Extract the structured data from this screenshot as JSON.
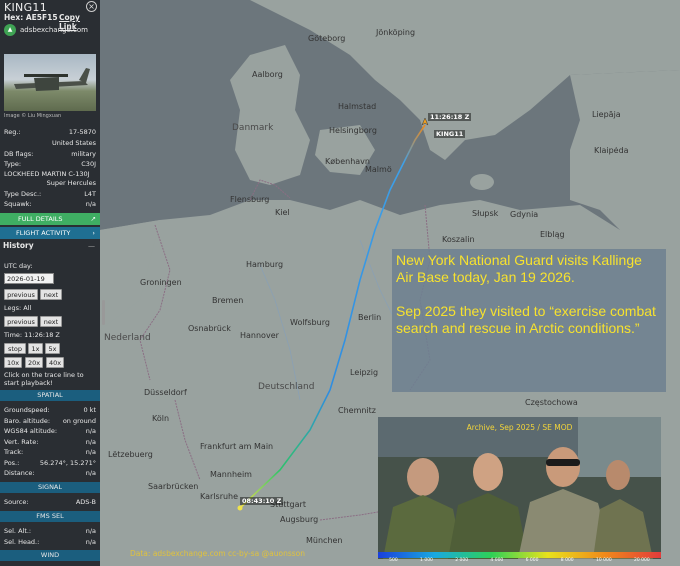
{
  "sidebar": {
    "callsign": "KING11",
    "hex_label": "Hex:",
    "hex": "AE5F15",
    "copy_link": "Copy Link",
    "source_site": "adsbexchange.com",
    "image_credit": "Image © Liu Mingxuan",
    "fields": [
      {
        "label": "Reg.:",
        "value": "17-5870"
      },
      {
        "label": "",
        "value": "United States"
      },
      {
        "label": "DB flags:",
        "value": "military"
      },
      {
        "label": "Type:",
        "value": "C30J"
      },
      {
        "label": "LOCKHEED MARTIN C-130J",
        "value": ""
      },
      {
        "label": "",
        "value": "Super Hercules"
      },
      {
        "label": "Type Desc.:",
        "value": "L4T"
      },
      {
        "label": "Squawk:",
        "value": "n/a"
      }
    ],
    "full_details": "FULL DETAILS",
    "flight_activity": "FLIGHT ACTIVITY",
    "history": "History",
    "utc_day_label": "UTC day:",
    "utc_day_value": "2026-01-19",
    "previous": "previous",
    "next": "next",
    "legs_label": "Legs: All",
    "time_label": "Time: 11:26:18 Z",
    "stop": "stop",
    "speeds": [
      "1x",
      "5x",
      "10x",
      "20x",
      "40x"
    ],
    "trace_hint": "Click on the trace line to start playback!",
    "spatial_header": "SPATIAL",
    "spatial": [
      {
        "label": "Groundspeed:",
        "value": "0 kt"
      },
      {
        "label": "Baro. altitude:",
        "value": "on ground"
      },
      {
        "label": "WGS84 altitude:",
        "value": "n/a"
      },
      {
        "label": "Vert. Rate:",
        "value": "n/a"
      },
      {
        "label": "Track:",
        "value": "n/a"
      },
      {
        "label": "Pos.:",
        "value": "56.274°, 15.271°"
      },
      {
        "label": "Distance:",
        "value": "n/a"
      }
    ],
    "signal_header": "SIGNAL",
    "signal": [
      {
        "label": "Source:",
        "value": "ADS-B"
      }
    ],
    "fms_header": "FMS SEL",
    "fms": [
      {
        "label": "Sel. Alt.:",
        "value": "n/a"
      },
      {
        "label": "Sel. Head.:",
        "value": "n/a"
      }
    ],
    "wind_header": "WIND"
  },
  "map": {
    "flight_label_end": "11:26:18 Z",
    "flight_label_callsign": "KING11",
    "flight_label_start": "08:43:10 Z",
    "labels": [
      {
        "text": "Göteborg"
      },
      {
        "text": "Jönköping"
      },
      {
        "text": "Aalborg"
      },
      {
        "text": "Halmstad"
      },
      {
        "text": "Danmark"
      },
      {
        "text": "Helsingborg"
      },
      {
        "text": "København"
      },
      {
        "text": "Malmö"
      },
      {
        "text": "Liepāja"
      },
      {
        "text": "Klaipėda"
      },
      {
        "text": "Flensburg"
      },
      {
        "text": "Kiel"
      },
      {
        "text": "Gdynia"
      },
      {
        "text": "Słupsk"
      },
      {
        "text": "Elbląg"
      },
      {
        "text": "Koszalin"
      },
      {
        "text": "Hamburg"
      },
      {
        "text": "Groningen"
      },
      {
        "text": "Bremen"
      },
      {
        "text": "Berlin"
      },
      {
        "text": "Nederland"
      },
      {
        "text": "Osnabrück"
      },
      {
        "text": "Hannover"
      },
      {
        "text": "Wolfsburg"
      },
      {
        "text": "Deutschland"
      },
      {
        "text": "Leipzig"
      },
      {
        "text": "Düsseldorf"
      },
      {
        "text": "Köln"
      },
      {
        "text": "Frankfurt am Main"
      },
      {
        "text": "Lëtzebuerg"
      },
      {
        "text": "Mannheim"
      },
      {
        "text": "Saarbrücken"
      },
      {
        "text": "Karlsruhe"
      },
      {
        "text": "Stuttgart"
      },
      {
        "text": "Augsburg"
      },
      {
        "text": "München"
      },
      {
        "text": "Chemnitz"
      },
      {
        "text": "Częstochowa"
      }
    ],
    "attribution": "Data: adsbexchange.com cc-by-sa @auonsson"
  },
  "overlay": {
    "para1": "New York National Guard visits Kallinge Air Base today, Jan 19 2026.",
    "para2": "Sep 2025 they visited to “exercise combat search and rescue in Arctic conditions.”"
  },
  "inset": {
    "caption": "Archive, Sep 2025 / SE MOD"
  },
  "altitude_scale": [
    "500",
    "1 000",
    "2 000",
    "4 000",
    "6 000",
    "8 000",
    "10 000",
    "20 000"
  ]
}
